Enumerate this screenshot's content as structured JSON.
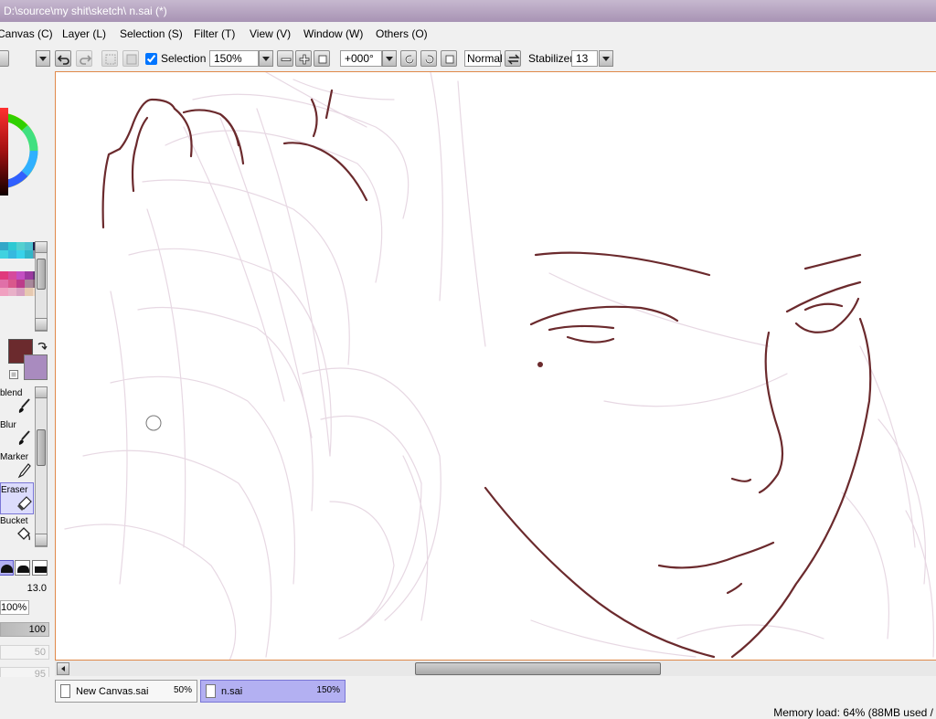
{
  "window": {
    "title": "D:\\source\\my shit\\sketch\\ n.sai (*)"
  },
  "menu": [
    {
      "label": "Canvas (C)"
    },
    {
      "label": "Layer (L)"
    },
    {
      "label": "Selection (S)"
    },
    {
      "label": "Filter (T)"
    },
    {
      "label": "View (V)"
    },
    {
      "label": "Window (W)"
    },
    {
      "label": "Others (O)"
    }
  ],
  "toolbar": {
    "selection_label": "Selection",
    "selection_checked": true,
    "zoom": "150%",
    "rotation": "+000°",
    "blend_mode": "Normal",
    "stabilizer_label": "Stabilizer",
    "stabilizer_value": "13"
  },
  "colors": {
    "primary": "#6b2a2d",
    "secondary": "#a98bbf",
    "accent_border": "#e0894a",
    "active_tab": "#b3b0f2",
    "sketch_line": "#6b2a2d",
    "sketch_faint": "#e7d8e3"
  },
  "palette": [
    [
      "#33a7c8",
      "#2ec9d3",
      "#53d0d0",
      "#4dc0d0",
      "#20204a"
    ],
    [
      "#40d2e0",
      "#36b9df",
      "#38d2ea",
      "#31b6c8",
      "#7d8fa2"
    ],
    [
      "#e03a7c",
      "#d64a9c",
      "#c34fc2",
      "#9c3aa0",
      "#6a3a7c"
    ],
    [
      "#e070a8",
      "#d9588c",
      "#bc3c8a",
      "#a9889c",
      "#8c6e7c"
    ],
    [
      "#f0a0c0",
      "#e8b0c8",
      "#d8a0c0",
      "#e6c9b0",
      "#f2dcc8"
    ]
  ],
  "tools": [
    {
      "label": "blend",
      "icon": "brush-icon"
    },
    {
      "label": "Blur",
      "icon": "brush-icon"
    },
    {
      "label": "Marker",
      "icon": "marker-icon"
    },
    {
      "label": "Eraser",
      "icon": "eraser-icon",
      "selected": true
    },
    {
      "label": "Bucket",
      "icon": "bucket-icon"
    }
  ],
  "brush": {
    "size": "13.0",
    "size_multiplier": "100%",
    "density": "100",
    "disabled_value_1": "50",
    "disabled_value_2": "95"
  },
  "tabs": [
    {
      "name": "New Canvas.sai",
      "zoom": "50%",
      "active": false
    },
    {
      "name": "n.sai",
      "zoom": "150%",
      "active": true
    }
  ],
  "status": {
    "text": "Memory load: 64% (88MB used /"
  }
}
